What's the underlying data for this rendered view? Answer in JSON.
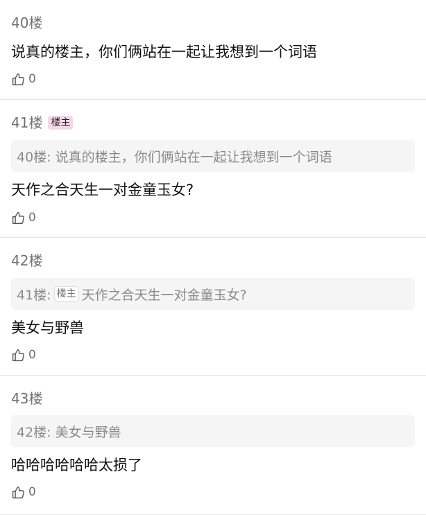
{
  "posts": [
    {
      "floor": "40楼",
      "content": "说真的楼主，你们俩站在一起让我想到一个词语",
      "likes": "0"
    },
    {
      "floor": "41楼",
      "badge": "楼主",
      "quote": {
        "ref": "40楼:",
        "text": "说真的楼主，你们俩站在一起让我想到一个词语"
      },
      "content": "天作之合天生一对金童玉女?",
      "likes": "0"
    },
    {
      "floor": "42楼",
      "quote": {
        "ref": "41楼:",
        "badge": "楼主",
        "text": "天作之合天生一对金童玉女?"
      },
      "content": "美女与野兽",
      "likes": "0"
    },
    {
      "floor": "43楼",
      "quote": {
        "ref": "42楼:",
        "text": "美女与野兽"
      },
      "content": "哈哈哈哈哈哈太损了",
      "likes": "0"
    }
  ],
  "icons": {
    "like": "thumbs-up-icon"
  },
  "colors": {
    "op_badge_bg": "#f7d7e7",
    "quote_bg": "#f5f5f5",
    "muted_text": "#707070"
  }
}
